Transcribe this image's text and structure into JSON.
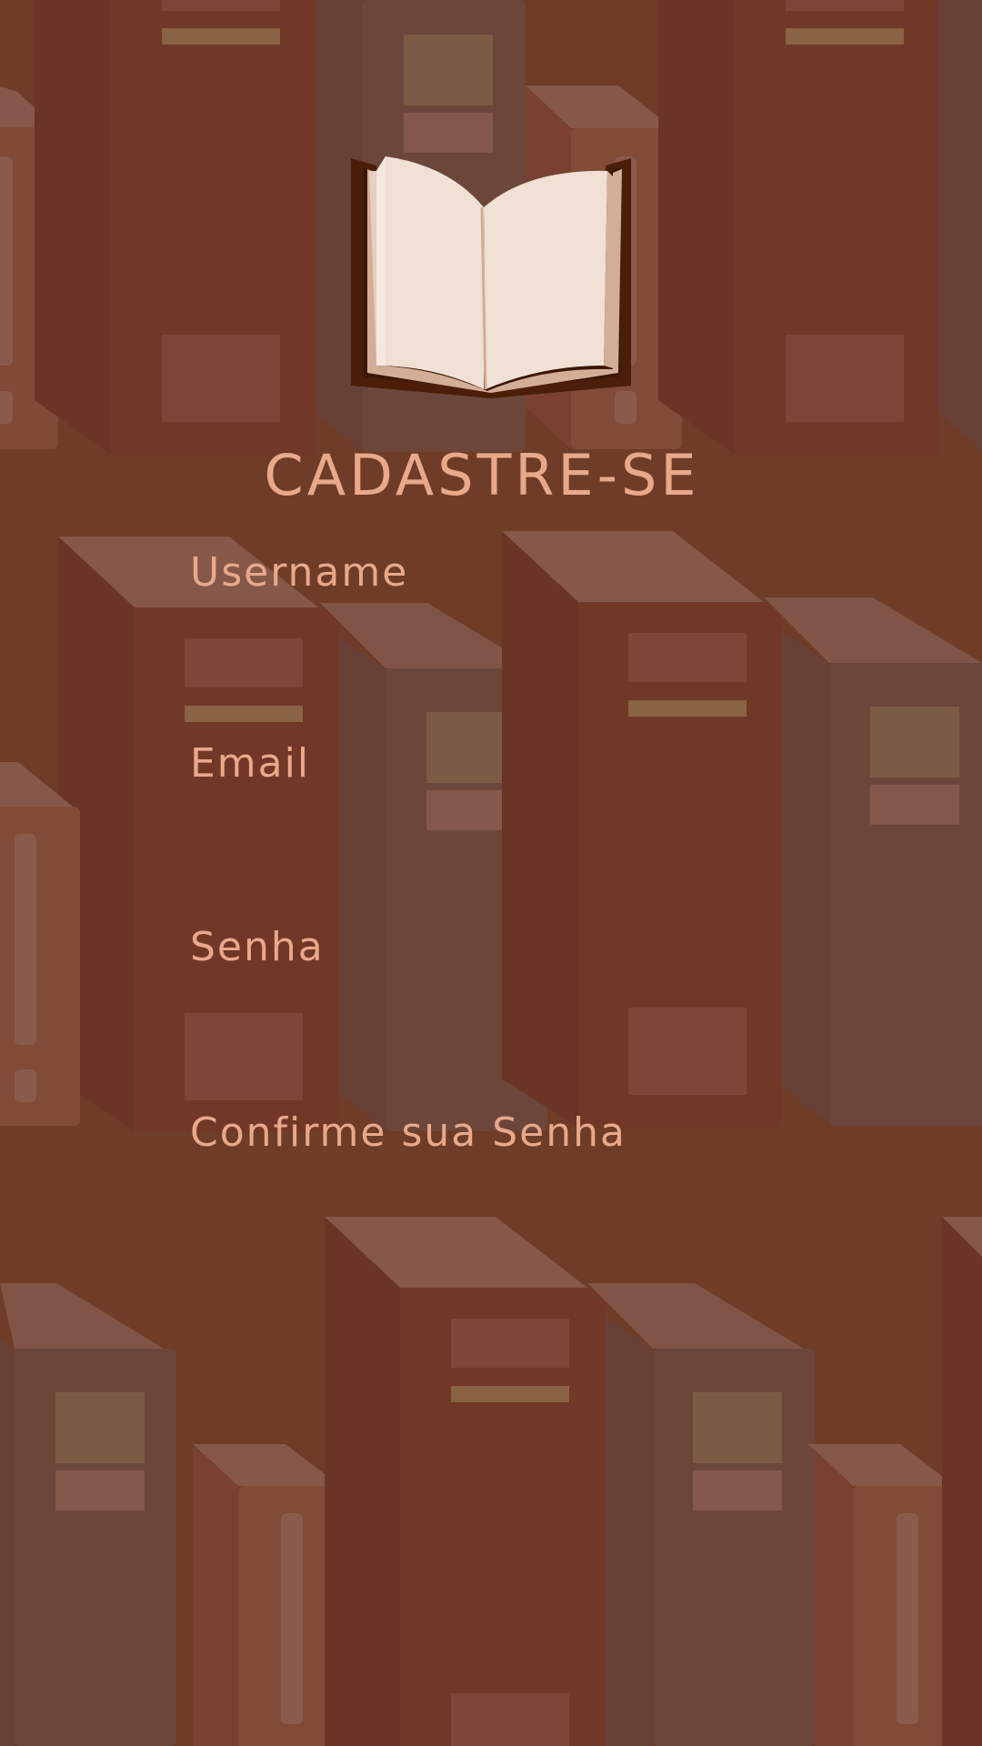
{
  "title": "CADASTRE-SE",
  "form": {
    "username_label": "Username",
    "email_label": "Email",
    "password_label": "Senha",
    "confirm_password_label": "Confirme sua Senha",
    "username_value": "",
    "email_value": "",
    "password_value": "",
    "confirm_password_value": ""
  },
  "icons": {
    "logo": "open-book-icon"
  },
  "colors": {
    "background": "#6e3c27",
    "text": "#e8a98a"
  }
}
